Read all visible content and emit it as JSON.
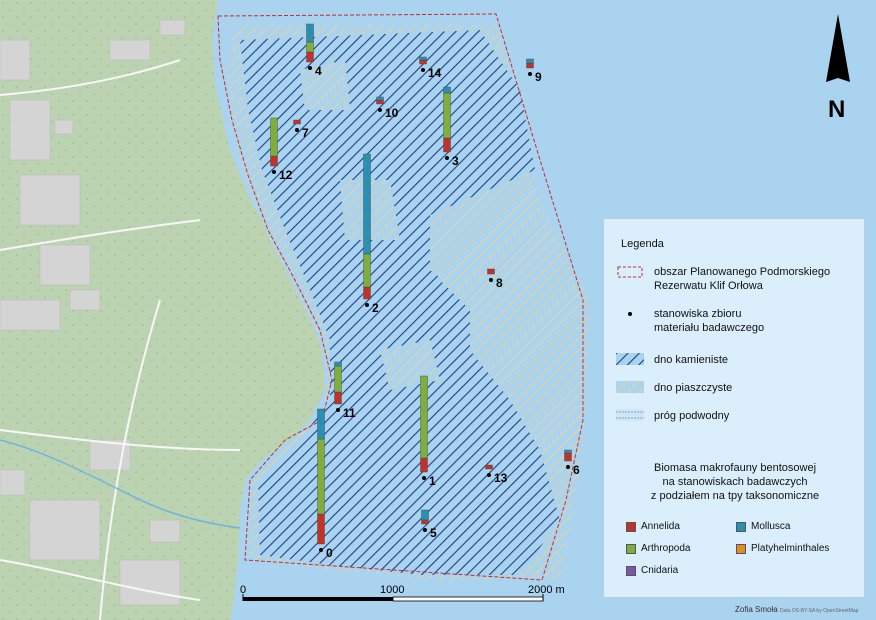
{
  "legend": {
    "title": "Legenda",
    "reserve_area": "obszar Planowanego Podmorskiego\nRezerwatu Klif Orłowa",
    "stations": "stanowiska zbioru\nmateriału badawczego",
    "rocky_bottom": "dno kamieniste",
    "sandy_bottom": "dno piaszczyste",
    "sill": "próg podwodny",
    "biomass_title": "Biomasa makrofauny bentosowej\nna stanowiskach badawczych\nz podziałem na tpy taksonomiczne",
    "taxa": [
      {
        "name": "Annelida",
        "color": "#c0332b"
      },
      {
        "name": "Mollusca",
        "color": "#2a8fb0"
      },
      {
        "name": "Arthropoda",
        "color": "#7fae3c"
      },
      {
        "name": "Platyhelminthales",
        "color": "#e08a2a"
      },
      {
        "name": "Cnidaria",
        "color": "#7a57a8"
      }
    ]
  },
  "scale": {
    "l0": "0",
    "l1": "1000",
    "l2": "2000 m"
  },
  "north": "N",
  "author": "Zofia Smoła",
  "attribution": "Data OS-BY-SA by OpenStreetMap",
  "stations": [
    {
      "id": "0",
      "annelida": 30,
      "mollusca": 30,
      "arthropoda": 75,
      "platy": 0,
      "cnidaria": 0
    },
    {
      "id": "1",
      "annelida": 14,
      "mollusca": 0,
      "arthropoda": 82,
      "platy": 0,
      "cnidaria": 0
    },
    {
      "id": "2",
      "annelida": 12,
      "mollusca": 100,
      "arthropoda": 33,
      "platy": 0,
      "cnidaria": 0
    },
    {
      "id": "3",
      "annelida": 14,
      "mollusca": 6,
      "arthropoda": 45,
      "platy": 0,
      "cnidaria": 0
    },
    {
      "id": "4",
      "annelida": 10,
      "mollusca": 18,
      "arthropoda": 10,
      "platy": 0,
      "cnidaria": 0
    },
    {
      "id": "5",
      "annelida": 4,
      "mollusca": 10,
      "arthropoda": 0,
      "platy": 0,
      "cnidaria": 0
    },
    {
      "id": "6",
      "annelida": 8,
      "mollusca": 3,
      "arthropoda": 0,
      "platy": 0,
      "cnidaria": 0
    },
    {
      "id": "7",
      "annelida": 4,
      "mollusca": 0,
      "arthropoda": 0,
      "platy": 0,
      "cnidaria": 0
    },
    {
      "id": "8",
      "annelida": 5,
      "mollusca": 0,
      "arthropoda": 0,
      "platy": 0,
      "cnidaria": 0
    },
    {
      "id": "9",
      "annelida": 5,
      "mollusca": 4,
      "arthropoda": 0,
      "platy": 0,
      "cnidaria": 0
    },
    {
      "id": "10",
      "annelida": 4,
      "mollusca": 3,
      "arthropoda": 0,
      "platy": 0,
      "cnidaria": 0
    },
    {
      "id": "11",
      "annelida": 12,
      "mollusca": 4,
      "arthropoda": 26,
      "platy": 0,
      "cnidaria": 0
    },
    {
      "id": "12",
      "annelida": 10,
      "mollusca": 0,
      "arthropoda": 38,
      "platy": 0,
      "cnidaria": 0
    },
    {
      "id": "13",
      "annelida": 4,
      "mollusca": 0,
      "arthropoda": 0,
      "platy": 0,
      "cnidaria": 0
    },
    {
      "id": "14",
      "annelida": 4,
      "mollusca": 3,
      "arthropoda": 0,
      "platy": 0,
      "cnidaria": 0
    }
  ]
}
